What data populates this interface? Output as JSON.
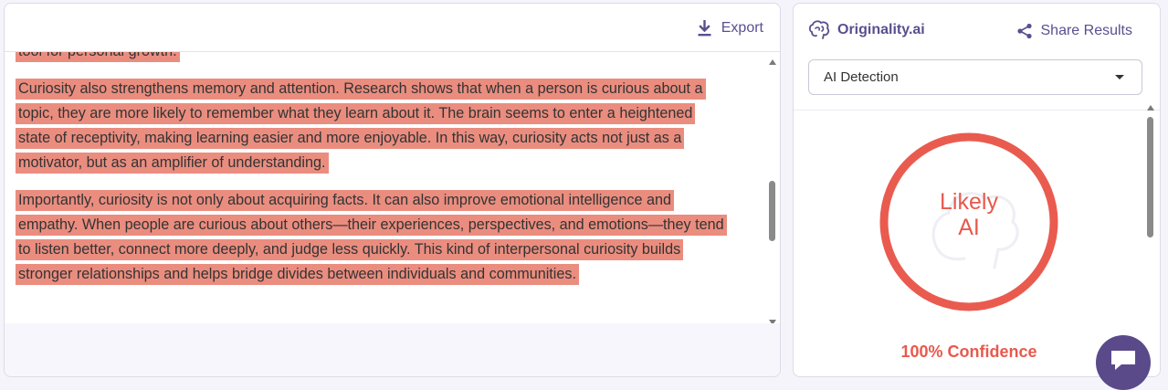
{
  "editor": {
    "export_label": "Export",
    "paragraphs": [
      "tool for personal growth.",
      "Curiosity also strengthens memory and attention.  Research shows that when a person is curious about a topic, they are more likely to remember what they learn about it.  The brain seems to enter a heightened state of receptivity, making learning easier and more enjoyable.  In this way, curiosity acts not just as a motivator, but as an amplifier of understanding.",
      "Importantly, curiosity is not only about acquiring facts.  It can also improve emotional intelligence and empathy.  When people are curious about others—their experiences, perspectives, and emotions—they tend to listen better, connect more deeply, and judge less quickly.  This kind of interpersonal curiosity builds stronger relationships and helps bridge divides between individuals and communities."
    ],
    "highlight_color": "#ea8d7f"
  },
  "results": {
    "brand_name": "Originality.ai",
    "share_label": "Share Results",
    "detection_mode": "AI Detection",
    "verdict_line1": "Likely",
    "verdict_line2": "AI",
    "confidence_text": "100% Confidence",
    "accent_color": "#e8594d",
    "brand_color": "#5a4f8f"
  },
  "icons": [
    "download-icon",
    "brain-icon",
    "share-icon",
    "chevron-down-icon",
    "chat-icon"
  ]
}
